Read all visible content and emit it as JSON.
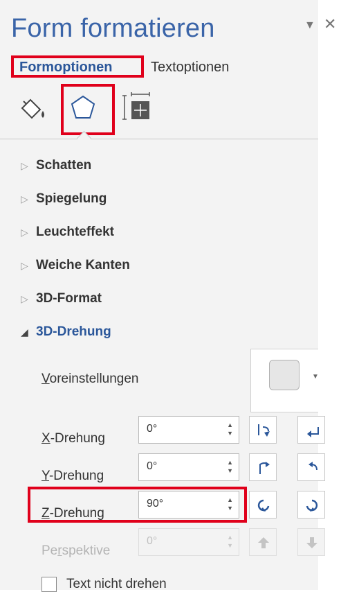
{
  "pane": {
    "title": "Form formatieren",
    "dropdown_icon": "chevron-down-icon",
    "close_icon": "close-icon"
  },
  "tabs": [
    {
      "label": "Formoptionen",
      "active": true
    },
    {
      "label": "Textoptionen",
      "active": false
    }
  ],
  "icon_tabs": [
    {
      "name": "fill-line-icon",
      "active": false
    },
    {
      "name": "effects-pentagon-icon",
      "active": true
    },
    {
      "name": "size-properties-icon",
      "active": false
    }
  ],
  "sections": [
    {
      "label": "Schatten",
      "expanded": false
    },
    {
      "label": "Spiegelung",
      "expanded": false
    },
    {
      "label": "Leuchteffekt",
      "expanded": false
    },
    {
      "label": "Weiche Kanten",
      "expanded": false
    },
    {
      "label": "3D-Format",
      "expanded": false
    },
    {
      "label": "3D-Drehung",
      "expanded": true
    }
  ],
  "rotation": {
    "presets_label_prefix": "V",
    "presets_label_rest": "oreinstellungen",
    "x": {
      "label_prefix": "X",
      "label_rest": "-Drehung",
      "value": "0°"
    },
    "y": {
      "label_prefix": "Y",
      "label_rest": "-Drehung",
      "value": "0°"
    },
    "z": {
      "label_prefix": "Z",
      "label_rest": "-Drehung",
      "value": "90°"
    },
    "perspective": {
      "label_prefix": "Pe",
      "label_underlined": "r",
      "label_rest": "spektive",
      "value": "0°",
      "disabled": true
    },
    "keep_text_flat_label": "Text nicht drehen"
  },
  "highlight_color": "#e0001b",
  "accent_color": "#2b579a"
}
